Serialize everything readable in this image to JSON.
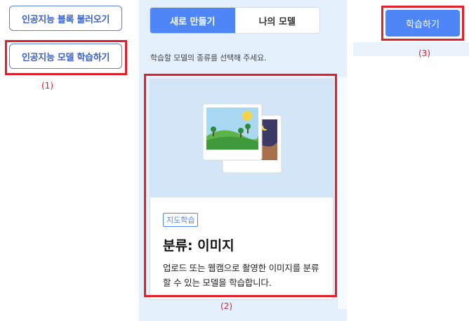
{
  "left": {
    "load_blocks_label": "인공지능 블록 불러오기",
    "train_model_label": "인공지능 모델 학습하기",
    "annotation": "(1)"
  },
  "panel": {
    "tabs": [
      {
        "label": "새로 만들기",
        "active": true
      },
      {
        "label": "나의 모델",
        "active": false
      }
    ],
    "guide_text": "학습할 모델의 종류를 선택해 주세요.",
    "card": {
      "badge": "지도학습",
      "title": "분류: 이미지",
      "description": "업로드 또는 웹캠으로 촬영한 이미지를 분류할 수 있는 모델을 학습합니다.",
      "illustration": "image-classification-icon"
    },
    "annotation": "(2)"
  },
  "right": {
    "learn_label": "학습하기",
    "annotation": "(3)"
  },
  "colors": {
    "accent": "#4f86f7",
    "highlight": "#e0202a",
    "panel_bg": "#e4f1fc"
  }
}
